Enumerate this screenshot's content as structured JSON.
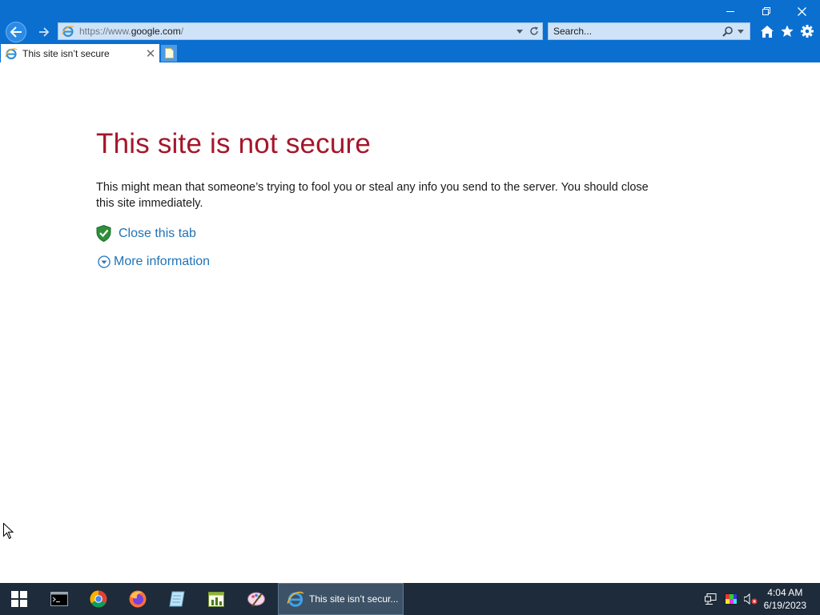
{
  "window": {
    "minimize_icon": "minimize-icon",
    "restore_icon": "restore-icon",
    "close_icon": "close-icon"
  },
  "browser": {
    "address": {
      "url_prefix": "https://www.",
      "url_host": "google.com",
      "url_suffix": "/"
    },
    "search": {
      "placeholder": "Search..."
    },
    "tab": {
      "title": "This site isn’t secure",
      "close_glyph": "✕"
    },
    "toolbar_icons": [
      "home-icon",
      "favorites-star-icon",
      "settings-gear-icon"
    ]
  },
  "page": {
    "title": "This site is not secure",
    "description": "This might mean that someone’s trying to fool you or steal any info you send to the server. You should close this site immediately.",
    "close_tab_label": "Close this tab",
    "more_info_label": "More information"
  },
  "taskbar": {
    "apps": [
      "command-prompt-icon",
      "chrome-icon",
      "firefox-icon",
      "notepad-icon",
      "spreadsheet-icon",
      "paint-icon"
    ],
    "active_window_label": "This site isn’t secur...",
    "time": "4:04 AM",
    "date": "6/19/2023"
  },
  "colors": {
    "chrome_blue": "#0b6fd0",
    "title_red": "#a5162a",
    "link_blue": "#2173b6",
    "taskbar": "#1d2b3a"
  }
}
